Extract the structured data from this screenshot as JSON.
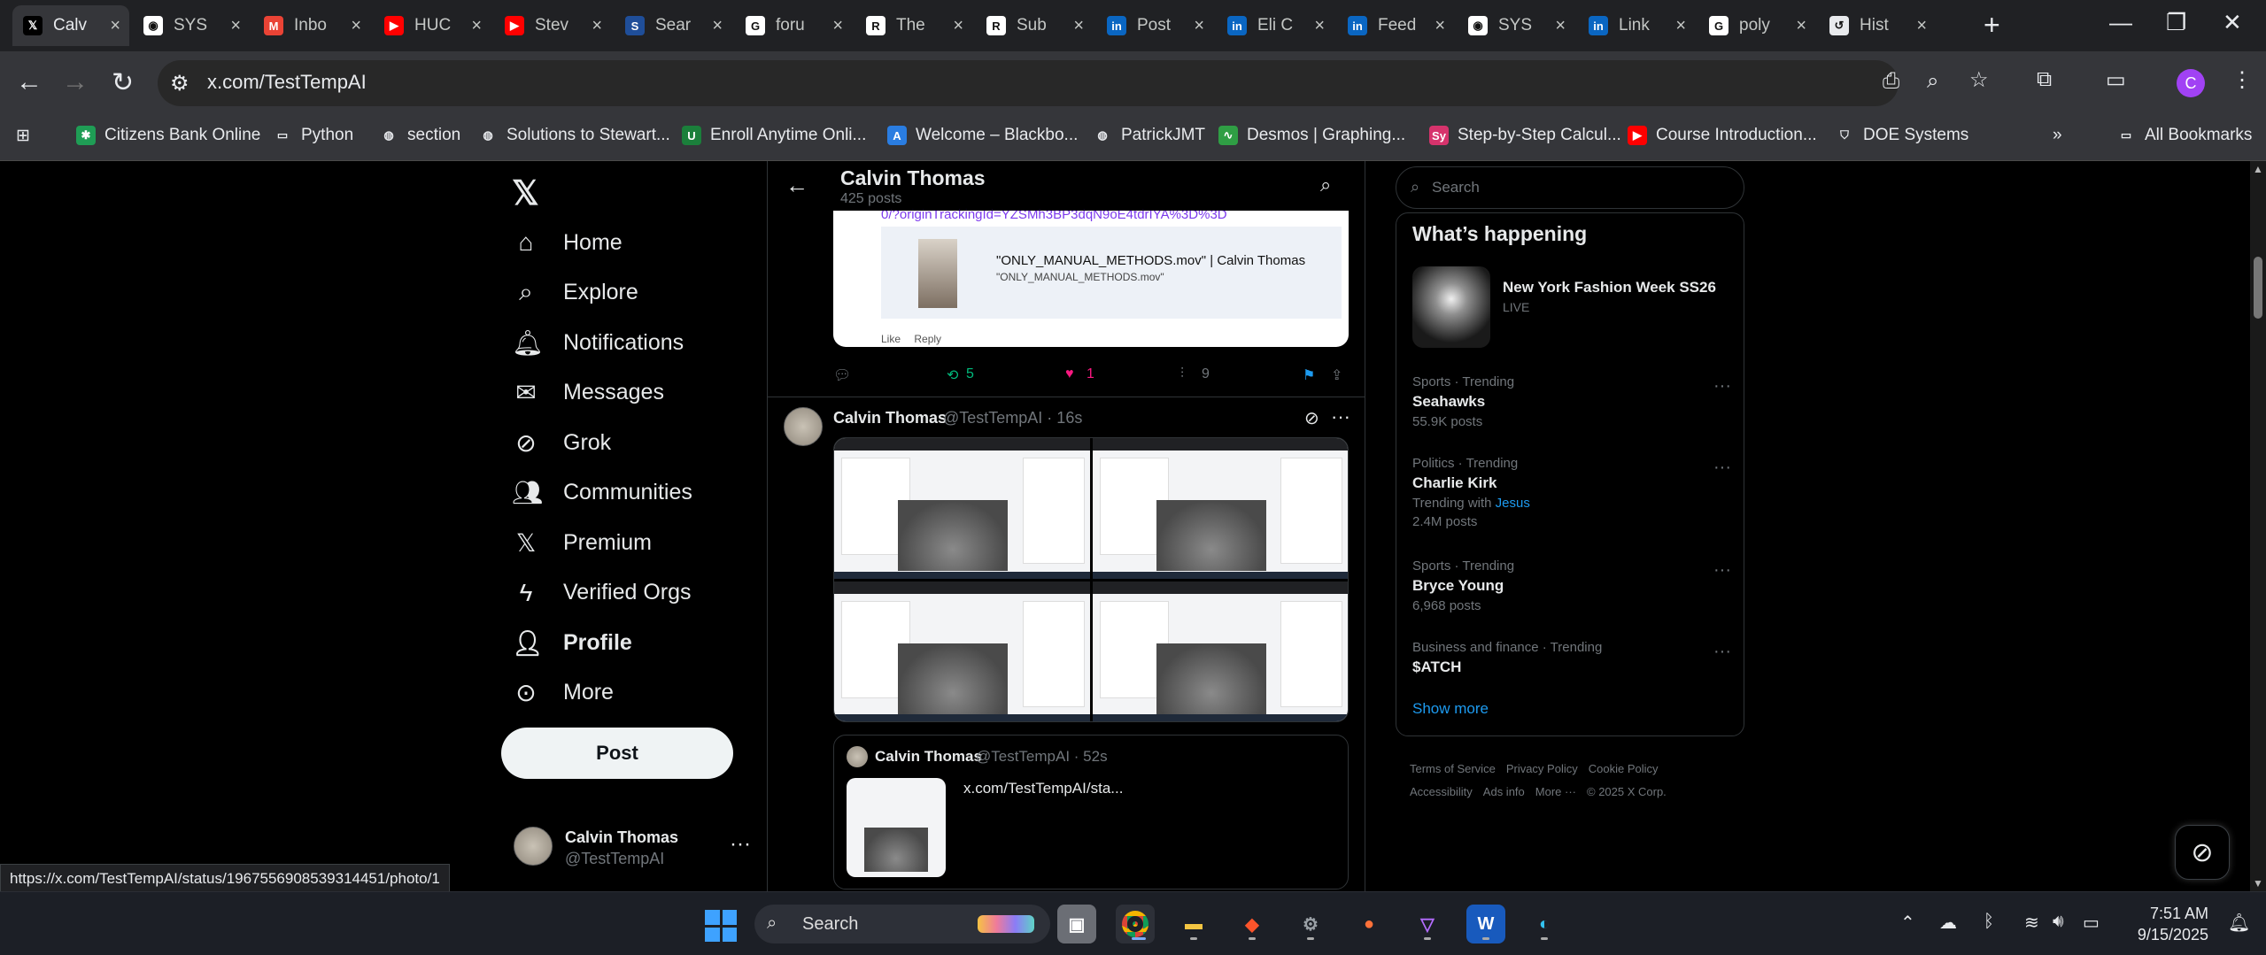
{
  "browser": {
    "tabs": [
      {
        "label": "Calv",
        "icon": "x-icon",
        "color": "#000000",
        "active": true
      },
      {
        "label": "SYS",
        "icon": "github-icon",
        "color": "#ffffff"
      },
      {
        "label": "Inbo",
        "icon": "gmail-icon",
        "color": "#ea4335"
      },
      {
        "label": "HUC",
        "icon": "youtube-icon",
        "color": "#ff0000"
      },
      {
        "label": "Stev",
        "icon": "youtube-icon",
        "color": "#ff0000"
      },
      {
        "label": "Sear",
        "icon": "ssrn-icon",
        "color": "#1f4e99"
      },
      {
        "label": "foru",
        "icon": "google-icon",
        "color": "#ffffff"
      },
      {
        "label": "The",
        "icon": "researchgate-icon",
        "color": "#ffffff"
      },
      {
        "label": "Sub",
        "icon": "researchgate-icon",
        "color": "#ffffff"
      },
      {
        "label": "Post",
        "icon": "linkedin-icon",
        "color": "#0a66c2"
      },
      {
        "label": "Eli C",
        "icon": "linkedin-icon",
        "color": "#0a66c2"
      },
      {
        "label": "Feed",
        "icon": "linkedin-icon",
        "color": "#0a66c2"
      },
      {
        "label": "SYS",
        "icon": "github-icon",
        "color": "#ffffff"
      },
      {
        "label": "Link",
        "icon": "linkedin-icon",
        "color": "#0a66c2"
      },
      {
        "label": "poly",
        "icon": "google-icon",
        "color": "#ffffff"
      },
      {
        "label": "Hist",
        "icon": "history-icon",
        "color": "#e8eaed"
      }
    ],
    "url": "x.com/TestTempAI",
    "profile_initial": "C",
    "bookmarks": [
      {
        "label": "Citizens Bank Online",
        "icon": "citizens-icon",
        "color": "#1f9d55"
      },
      {
        "label": "Python",
        "icon": "folder-icon",
        "color": "#e8eaed"
      },
      {
        "label": "section",
        "icon": "globe-icon",
        "color": "#e8eaed"
      },
      {
        "label": "Solutions to Stewart...",
        "icon": "globe-icon",
        "color": "#e8eaed"
      },
      {
        "label": "Enroll Anytime Onli...",
        "icon": "unh-icon",
        "color": "#1b7f3b"
      },
      {
        "label": "Welcome – Blackbo...",
        "icon": "blackboard-icon",
        "color": "#2a7de1"
      },
      {
        "label": "PatrickJMT",
        "icon": "globe-icon",
        "color": "#e8eaed"
      },
      {
        "label": "Desmos | Graphing...",
        "icon": "desmos-icon",
        "color": "#2f9e44"
      },
      {
        "label": "Step-by-Step Calcul...",
        "icon": "symbolab-icon",
        "color": "#d6336c"
      },
      {
        "label": "Course Introduction...",
        "icon": "youtube-icon",
        "color": "#ff0000"
      },
      {
        "label": "DOE Systems",
        "icon": "shield-icon",
        "color": "#e8eaed"
      }
    ],
    "all_bookmarks": "All Bookmarks"
  },
  "nav": {
    "items": [
      {
        "label": "Home",
        "icon": "home-icon",
        "glyph": "⌂"
      },
      {
        "label": "Explore",
        "icon": "search-icon",
        "glyph": "⌕"
      },
      {
        "label": "Notifications",
        "icon": "bell-icon",
        "glyph": "🔔︎"
      },
      {
        "label": "Messages",
        "icon": "mail-icon",
        "glyph": "✉"
      },
      {
        "label": "Grok",
        "icon": "grok-icon",
        "glyph": "⊘"
      },
      {
        "label": "Communities",
        "icon": "communities-icon",
        "glyph": "👥︎"
      },
      {
        "label": "Premium",
        "icon": "x-premium-icon",
        "glyph": "𝕏"
      },
      {
        "label": "Verified Orgs",
        "icon": "lightning-icon",
        "glyph": "ϟ"
      },
      {
        "label": "Profile",
        "icon": "person-icon",
        "glyph": "👤︎",
        "bold": true
      },
      {
        "label": "More",
        "icon": "more-circle-icon",
        "glyph": "⊙"
      }
    ],
    "post_label": "Post",
    "account_name": "Calvin Thomas",
    "account_handle": "@TestTempAI"
  },
  "profile_header": {
    "name": "Calvin Thomas",
    "posts": "425 posts"
  },
  "tweet1": {
    "link_text": "0/?originTrackingId=YZSMh3BP3dqN9oE4tdrIYA%3D%3D",
    "embed_title": "\"ONLY_MANUAL_METHODS.mov\" | Calvin Thomas",
    "embed_sub": "\"ONLY_MANUAL_METHODS.mov\"",
    "like": "Like",
    "reply": "Reply",
    "retweets": "5",
    "likes": "1",
    "views": "9"
  },
  "tweet2": {
    "name": "Calvin Thomas",
    "handle_time": "@TestTempAI · 16s",
    "quote_name": "Calvin Thomas",
    "quote_handle_time": "@TestTempAI · 52s",
    "quote_text": "x.com/TestTempAI/sta..."
  },
  "right": {
    "search_placeholder": "Search",
    "happening_title": "What’s happening",
    "event_title": "New York Fashion Week SS26",
    "event_status": "LIVE",
    "trends": [
      {
        "category": "Sports · Trending",
        "title": "Seahawks",
        "posts": "55.9K posts"
      },
      {
        "category": "Politics · Trending",
        "title": "Charlie Kirk",
        "with_label": "Trending with",
        "with_value": "Jesus",
        "posts": "2.4M posts"
      },
      {
        "category": "Sports · Trending",
        "title": "Bryce Young",
        "posts": "6,968 posts"
      },
      {
        "category": "Business and finance · Trending",
        "title": "$ATCH",
        "posts": ""
      }
    ],
    "show_more": "Show more",
    "footer_links": [
      "Terms of Service",
      "Privacy Policy",
      "Cookie Policy",
      "Accessibility",
      "Ads info",
      "More ···",
      "© 2025 X Corp."
    ]
  },
  "status_url": "https://x.com/TestTempAI/status/1967556908539314451/photo/1",
  "taskbar": {
    "search_label": "Search",
    "time": "7:51 AM",
    "date": "9/15/2025"
  }
}
